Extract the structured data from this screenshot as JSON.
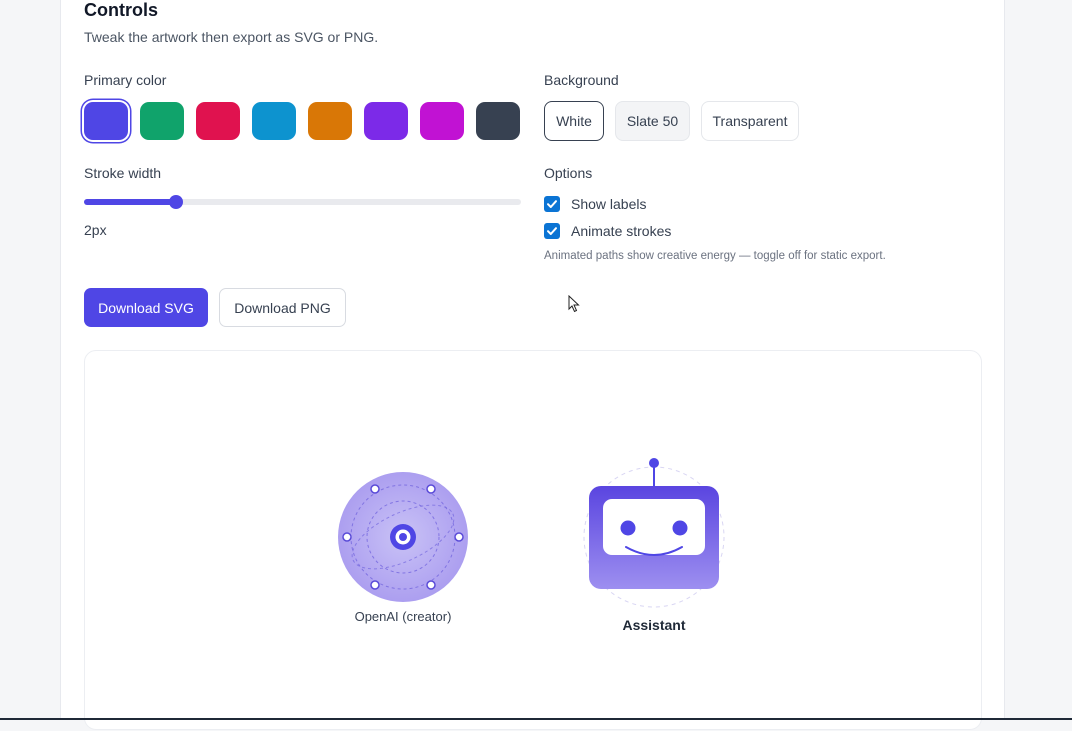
{
  "controls": {
    "title": "Controls",
    "subtitle": "Tweak the artwork then export as SVG or PNG."
  },
  "primary_color": {
    "label": "Primary color",
    "selected": "#4f46e5",
    "swatches": [
      "#4f46e5",
      "#10a36b",
      "#e0124f",
      "#0d93cf",
      "#d97706",
      "#7c2ae8",
      "#c112d3",
      "#374151"
    ]
  },
  "background": {
    "label": "Background",
    "options": [
      "White",
      "Slate 50",
      "Transparent"
    ],
    "selected": "White"
  },
  "stroke": {
    "label": "Stroke width",
    "value_label": "2px",
    "value": 2,
    "min": 1,
    "max": 10
  },
  "options": {
    "label": "Options",
    "show_labels": {
      "label": "Show labels",
      "checked": true
    },
    "animate_strokes": {
      "label": "Animate strokes",
      "checked": true
    },
    "hint": "Animated paths show creative energy — toggle off for static export."
  },
  "actions": {
    "download_svg": "Download SVG",
    "download_png": "Download PNG"
  },
  "artwork": {
    "creator_label": "OpenAI (creator)",
    "assistant_label": "Assistant",
    "creator_icon": "orbit-icon",
    "assistant_icon": "robot-icon"
  },
  "colors": {
    "accent": "#4f46e5",
    "checkbox": "#0b74d4"
  }
}
